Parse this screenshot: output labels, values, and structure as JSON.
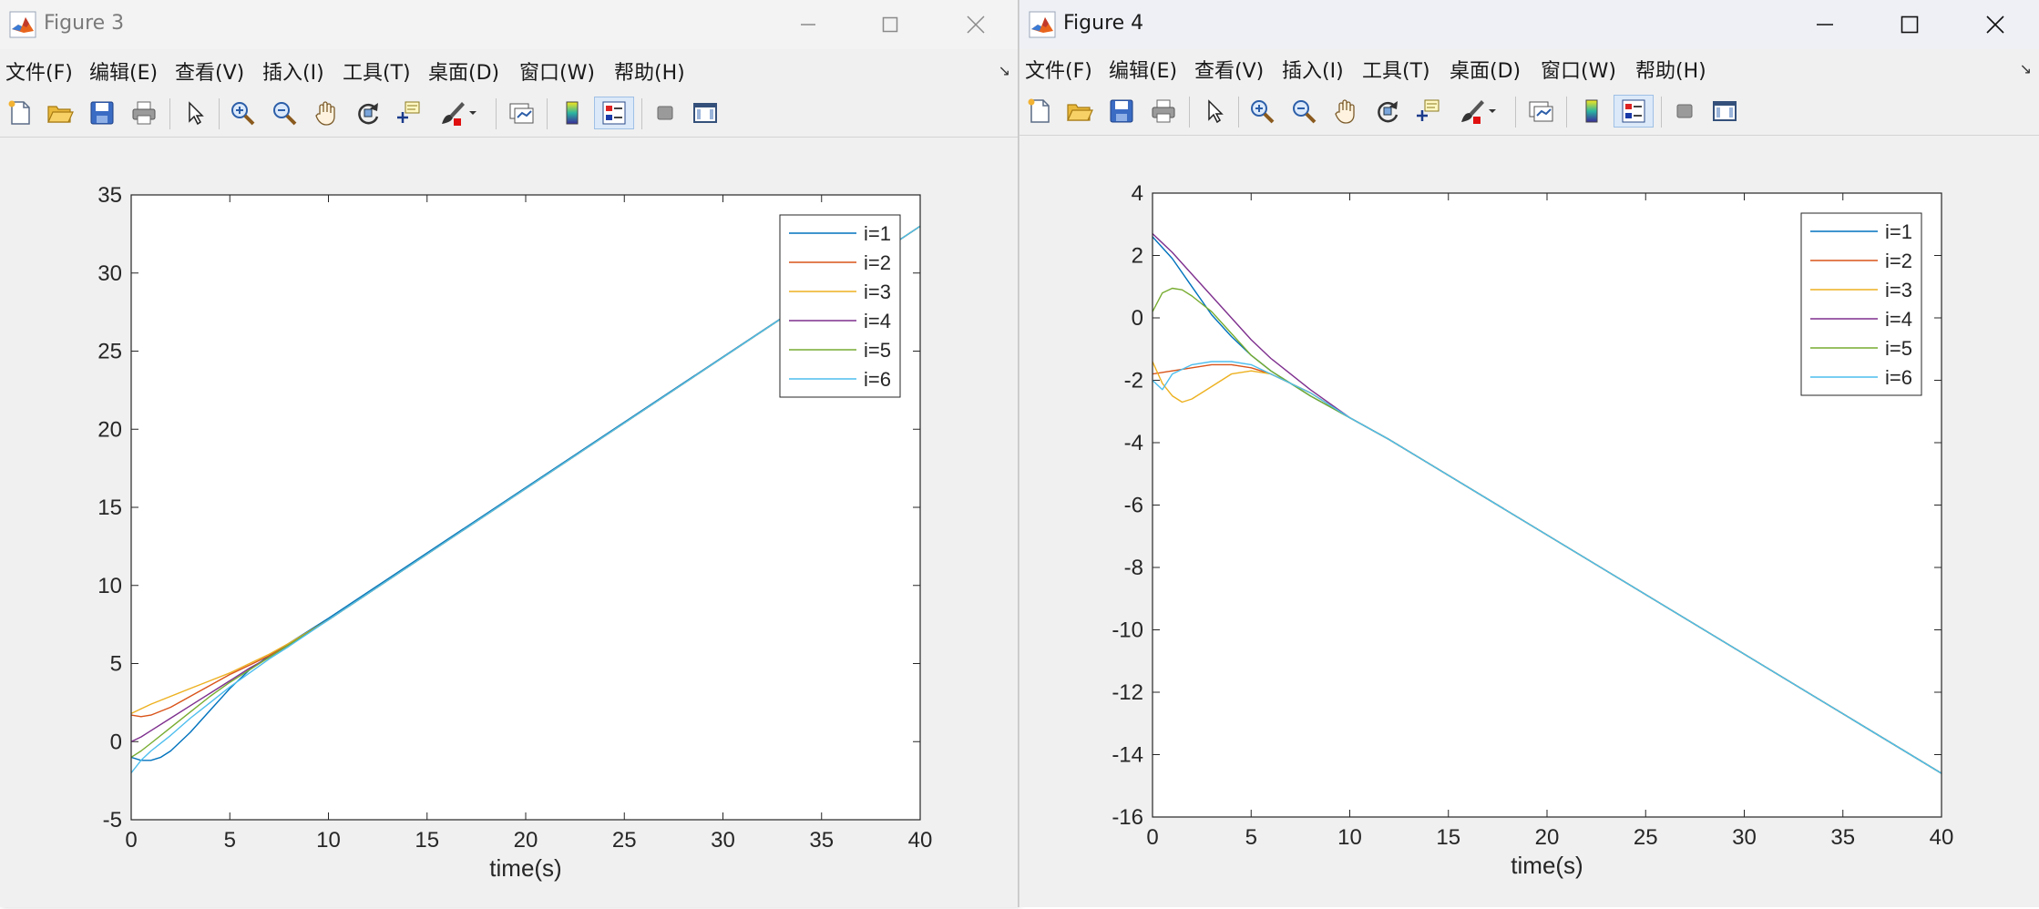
{
  "windows": [
    {
      "title": "Figure 3",
      "menu": [
        "文件(F)",
        "编辑(E)",
        "查看(V)",
        "插入(I)",
        "工具(T)",
        "桌面(D)",
        "窗口(W)",
        "帮助(H)"
      ],
      "dock_glyph": "↘",
      "toolbar_icons": [
        "new-figure-icon",
        "open-file-icon",
        "save-icon",
        "print-icon",
        "select-arrow-icon",
        "zoom-in-icon",
        "zoom-out-icon",
        "pan-hand-icon",
        "rotate-3d-icon",
        "data-cursor-icon",
        "brush-icon",
        "link-plot-icon",
        "colorbar-icon",
        "legend-icon",
        "hide-plot-tools-icon",
        "show-plot-tools-icon"
      ],
      "chart_data": {
        "type": "line",
        "xlabel": "time(s)",
        "ylabel": "",
        "title": "",
        "xlim": [
          0,
          40
        ],
        "ylim": [
          -5,
          35
        ],
        "xticks": [
          "0",
          "5",
          "10",
          "15",
          "20",
          "25",
          "30",
          "35",
          "40"
        ],
        "yticks": [
          "-5",
          "0",
          "5",
          "10",
          "15",
          "20",
          "25",
          "30",
          "35"
        ],
        "legend_position": "top-right",
        "grid": false,
        "series": [
          {
            "name": "i=1",
            "color": "#0072BD",
            "x": [
              0,
              0.5,
              1,
              1.5,
              2,
              3,
              4,
              5,
              6,
              7,
              8,
              10,
              40
            ],
            "y": [
              -1.0,
              -1.2,
              -1.2,
              -1.0,
              -0.6,
              0.6,
              2.0,
              3.4,
              4.6,
              5.5,
              6.3,
              7.9,
              33.0
            ]
          },
          {
            "name": "i=2",
            "color": "#D95319",
            "x": [
              0,
              0.5,
              1,
              2,
              3,
              4,
              5,
              6,
              7,
              8,
              10,
              40
            ],
            "y": [
              1.7,
              1.6,
              1.7,
              2.2,
              2.9,
              3.6,
              4.3,
              4.9,
              5.5,
              6.2,
              7.8,
              33.0
            ]
          },
          {
            "name": "i=3",
            "color": "#EDB120",
            "x": [
              0,
              0.5,
              1,
              2,
              3,
              4,
              5,
              6,
              7,
              8,
              10,
              40
            ],
            "y": [
              1.8,
              2.1,
              2.4,
              2.9,
              3.4,
              3.9,
              4.4,
              5.0,
              5.6,
              6.3,
              7.8,
              33.0
            ]
          },
          {
            "name": "i=4",
            "color": "#7E2F8E",
            "x": [
              0,
              0.5,
              1,
              2,
              3,
              4,
              5,
              6,
              7,
              8,
              10,
              40
            ],
            "y": [
              0.0,
              0.3,
              0.7,
              1.5,
              2.3,
              3.1,
              3.9,
              4.7,
              5.4,
              6.2,
              7.8,
              33.0
            ]
          },
          {
            "name": "i=5",
            "color": "#77AC30",
            "x": [
              0,
              0.5,
              1,
              2,
              3,
              4,
              5,
              6,
              7,
              8,
              10,
              40
            ],
            "y": [
              -1.0,
              -0.6,
              -0.1,
              0.9,
              1.9,
              2.9,
              3.8,
              4.6,
              5.4,
              6.2,
              7.8,
              33.0
            ]
          },
          {
            "name": "i=6",
            "color": "#4DBEEE",
            "x": [
              0,
              0.5,
              1,
              2,
              3,
              4,
              5,
              6,
              7,
              8,
              10,
              40
            ],
            "y": [
              -2.0,
              -1.2,
              -0.6,
              0.4,
              1.5,
              2.5,
              3.5,
              4.4,
              5.3,
              6.1,
              7.8,
              33.0
            ]
          }
        ]
      }
    },
    {
      "title": "Figure 4",
      "menu": [
        "文件(F)",
        "编辑(E)",
        "查看(V)",
        "插入(I)",
        "工具(T)",
        "桌面(D)",
        "窗口(W)",
        "帮助(H)"
      ],
      "dock_glyph": "↘",
      "toolbar_icons": [
        "new-figure-icon",
        "open-file-icon",
        "save-icon",
        "print-icon",
        "select-arrow-icon",
        "zoom-in-icon",
        "zoom-out-icon",
        "pan-hand-icon",
        "rotate-3d-icon",
        "data-cursor-icon",
        "brush-icon",
        "link-plot-icon",
        "colorbar-icon",
        "legend-icon",
        "hide-plot-tools-icon",
        "show-plot-tools-icon"
      ],
      "chart_data": {
        "type": "line",
        "xlabel": "time(s)",
        "ylabel": "",
        "title": "",
        "xlim": [
          0,
          40
        ],
        "ylim": [
          -16,
          4
        ],
        "xticks": [
          "0",
          "5",
          "10",
          "15",
          "20",
          "25",
          "30",
          "35",
          "40"
        ],
        "yticks": [
          "-16",
          "-14",
          "-12",
          "-10",
          "-8",
          "-6",
          "-4",
          "-2",
          "0",
          "2",
          "4"
        ],
        "legend_position": "top-right",
        "grid": false,
        "series": [
          {
            "name": "i=1",
            "color": "#0072BD",
            "x": [
              0,
              1,
              2,
              3,
              4,
              5,
              6,
              7,
              8,
              10,
              12,
              40
            ],
            "y": [
              2.6,
              1.9,
              1.0,
              0.1,
              -0.6,
              -1.2,
              -1.7,
              -2.1,
              -2.5,
              -3.2,
              -3.9,
              -14.6
            ]
          },
          {
            "name": "i=2",
            "color": "#D95319",
            "x": [
              0,
              1,
              2,
              3,
              4,
              5,
              6,
              7,
              8,
              10,
              12,
              40
            ],
            "y": [
              -1.8,
              -1.7,
              -1.6,
              -1.5,
              -1.5,
              -1.6,
              -1.8,
              -2.1,
              -2.4,
              -3.2,
              -3.9,
              -14.6
            ]
          },
          {
            "name": "i=3",
            "color": "#EDB120",
            "x": [
              0,
              0.5,
              1,
              1.5,
              2,
              3,
              4,
              5,
              6,
              7,
              8,
              10,
              12,
              40
            ],
            "y": [
              -1.4,
              -2.1,
              -2.5,
              -2.7,
              -2.6,
              -2.2,
              -1.8,
              -1.7,
              -1.8,
              -2.1,
              -2.4,
              -3.2,
              -3.9,
              -14.6
            ]
          },
          {
            "name": "i=4",
            "color": "#7E2F8E",
            "x": [
              0,
              1,
              2,
              3,
              4,
              5,
              6,
              7,
              8,
              10,
              12,
              40
            ],
            "y": [
              2.7,
              2.1,
              1.4,
              0.7,
              0.0,
              -0.7,
              -1.3,
              -1.8,
              -2.3,
              -3.2,
              -3.9,
              -14.6
            ]
          },
          {
            "name": "i=5",
            "color": "#77AC30",
            "x": [
              0,
              0.5,
              1,
              1.5,
              2,
              3,
              4,
              5,
              6,
              7,
              8,
              10,
              12,
              40
            ],
            "y": [
              0.2,
              0.8,
              0.95,
              0.9,
              0.7,
              0.2,
              -0.5,
              -1.2,
              -1.7,
              -2.1,
              -2.5,
              -3.2,
              -3.9,
              -14.6
            ]
          },
          {
            "name": "i=6",
            "color": "#4DBEEE",
            "x": [
              0,
              0.5,
              1,
              2,
              3,
              4,
              5,
              6,
              7,
              8,
              10,
              12,
              40
            ],
            "y": [
              -2.0,
              -2.3,
              -1.8,
              -1.5,
              -1.4,
              -1.4,
              -1.5,
              -1.8,
              -2.1,
              -2.4,
              -3.2,
              -3.9,
              -14.6
            ]
          }
        ]
      }
    }
  ]
}
